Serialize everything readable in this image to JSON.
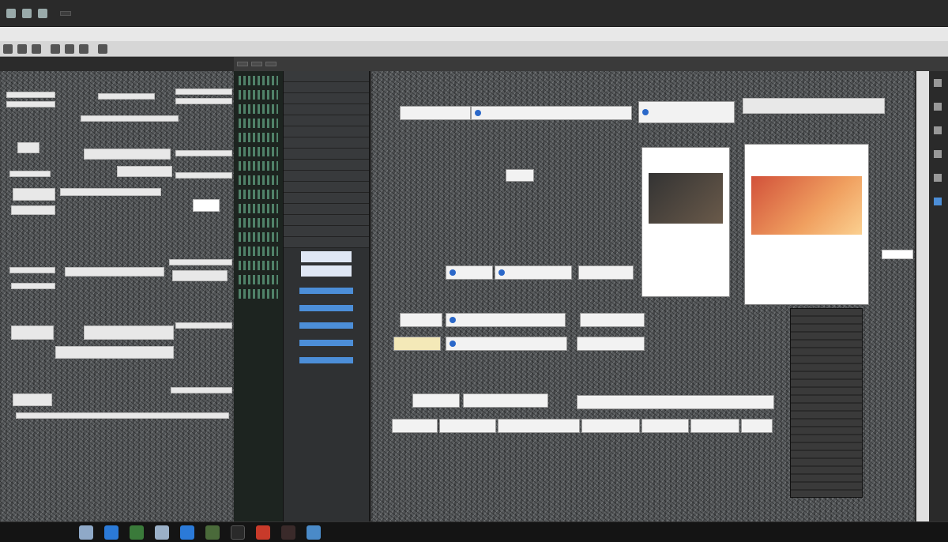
{
  "window": {
    "title": "",
    "path_field": ""
  },
  "menubar": {
    "left_items": [
      "",
      "",
      "",
      "",
      "",
      ""
    ],
    "right_items": [
      "",
      "",
      "",
      "",
      ""
    ]
  },
  "toolbar": {
    "labels": [
      "",
      "",
      ""
    ]
  },
  "tabs": [
    "",
    "",
    ""
  ],
  "list_rows": [
    "",
    "",
    "",
    "",
    "",
    "",
    "",
    "",
    "",
    "",
    "",
    "",
    "",
    "",
    "",
    ""
  ],
  "canvas": {
    "chips_row1": [
      "",
      "",
      ""
    ],
    "chips_row2": [
      "",
      "",
      ""
    ],
    "chips_row3": [
      "",
      "",
      ""
    ],
    "chips_row4": [
      "",
      "",
      "",
      ""
    ],
    "chips_row5": [
      "",
      "",
      "",
      "",
      "",
      "",
      ""
    ],
    "card1": {
      "heading": "",
      "text": ""
    },
    "card2": {
      "heading": "",
      "text": ""
    }
  },
  "taskbar": {
    "left_label": "",
    "clock": ""
  },
  "colors": {
    "selection_blue": "#4c8ed8",
    "code_green": "#66aa88",
    "card_heading": "#1a3a8a"
  }
}
